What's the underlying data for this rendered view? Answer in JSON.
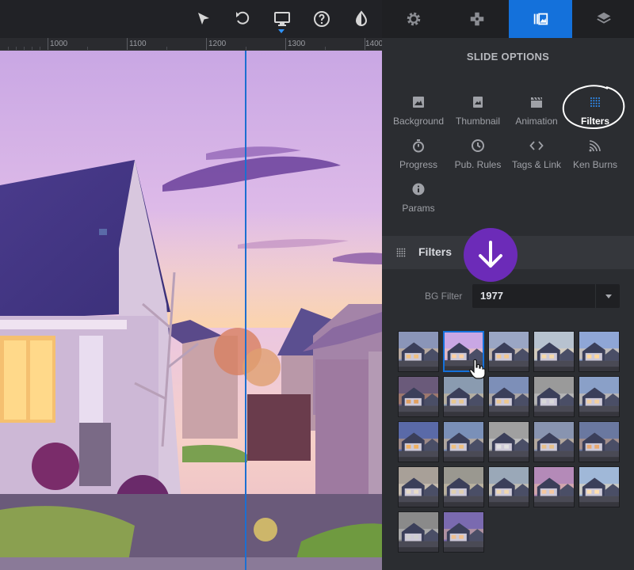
{
  "toolbar": {
    "icons": [
      "cursor-icon",
      "undo-icon",
      "desktop-icon",
      "help-icon",
      "contrast-icon"
    ]
  },
  "ruler": {
    "labels": [
      "1000",
      "1100",
      "1200",
      "1300",
      "1400"
    ]
  },
  "panel_tabs": {
    "icons": [
      "gear-icon",
      "puzzle-icon",
      "slides-icon",
      "layers-icon"
    ],
    "active": "slides-icon"
  },
  "slide_options": {
    "title": "SLIDE OPTIONS",
    "items": [
      {
        "label": "Background",
        "icon": "image-icon"
      },
      {
        "label": "Thumbnail",
        "icon": "thumbnail-icon"
      },
      {
        "label": "Animation",
        "icon": "clapper-icon"
      },
      {
        "label": "Filters",
        "icon": "filters-icon",
        "active": true
      },
      {
        "label": "Progress",
        "icon": "stopwatch-icon"
      },
      {
        "label": "Pub. Rules",
        "icon": "clock-icon"
      },
      {
        "label": "Tags & Link",
        "icon": "code-icon"
      },
      {
        "label": "Ken Burns",
        "icon": "kenburns-icon"
      },
      {
        "label": "Params",
        "icon": "info-icon"
      }
    ]
  },
  "filters_section": {
    "title": "Filters",
    "bg_filter_label": "BG Filter",
    "bg_filter_value": "1977"
  },
  "filter_thumbnails": {
    "selected_index": 1,
    "count": 22
  },
  "colors": {
    "accent_blue": "#1471db",
    "badge_purple": "#6c2bb8",
    "panel_bg": "#2b2d31"
  }
}
